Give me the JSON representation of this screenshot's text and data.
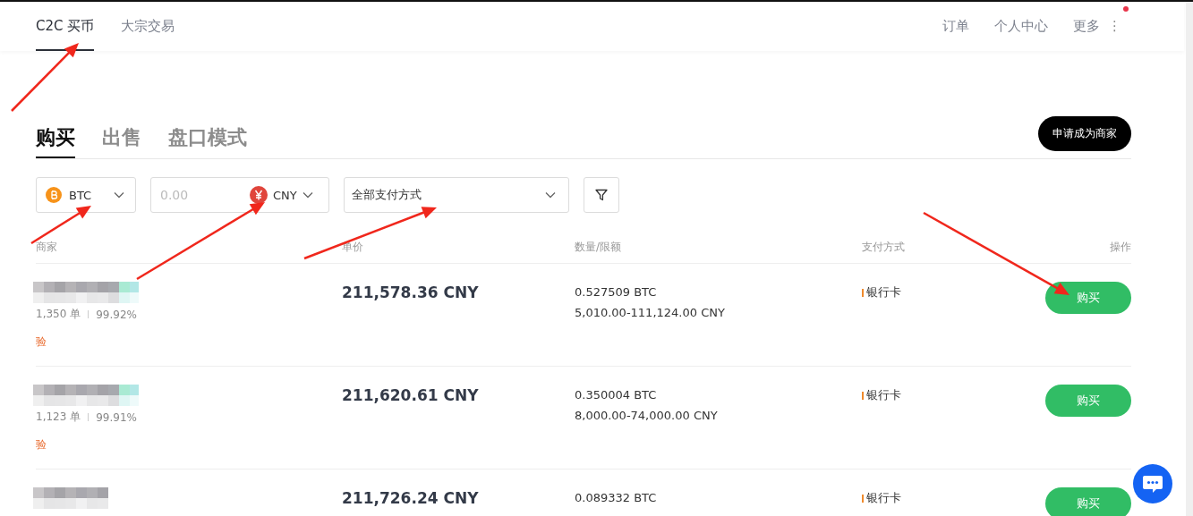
{
  "nav": {
    "tabs": [
      {
        "label": "C2C 买币",
        "selected": true
      },
      {
        "label": "大宗交易",
        "selected": false
      }
    ],
    "links": [
      "订单",
      "个人中心"
    ],
    "more": {
      "label": "更多",
      "menu_icon": "⋮",
      "notification": true
    }
  },
  "trade_tabs": [
    {
      "label": "购买",
      "selected": true
    },
    {
      "label": "出售",
      "selected": false
    },
    {
      "label": "盘口模式",
      "selected": false
    }
  ],
  "merchant_button": "申请成为商家",
  "filters": {
    "coin": "BTC",
    "amount": {
      "placeholder": "0.00"
    },
    "currency": "CNY",
    "payment": "全部支付方式"
  },
  "table": {
    "columns": [
      "商家",
      "单价",
      "数量/限额",
      "支付方式",
      "操作"
    ],
    "rows": [
      {
        "orders": "1,350 单",
        "completion": "99.92%",
        "badge": "验",
        "price": "211,578.36 CNY",
        "quantity": "0.527509 BTC",
        "limit": "5,010.00-111,124.00 CNY",
        "payment": "银行卡",
        "action": "购买"
      },
      {
        "orders": "1,123 单",
        "completion": "99.91%",
        "badge": "验",
        "price": "211,620.61 CNY",
        "quantity": "0.350004 BTC",
        "limit": "8,000.00-74,000.00 CNY",
        "payment": "银行卡",
        "action": "购买"
      },
      {
        "price": "211,726.24 CNY",
        "quantity": "0.089332 BTC",
        "payment": "银行卡",
        "action": "购买"
      }
    ]
  }
}
